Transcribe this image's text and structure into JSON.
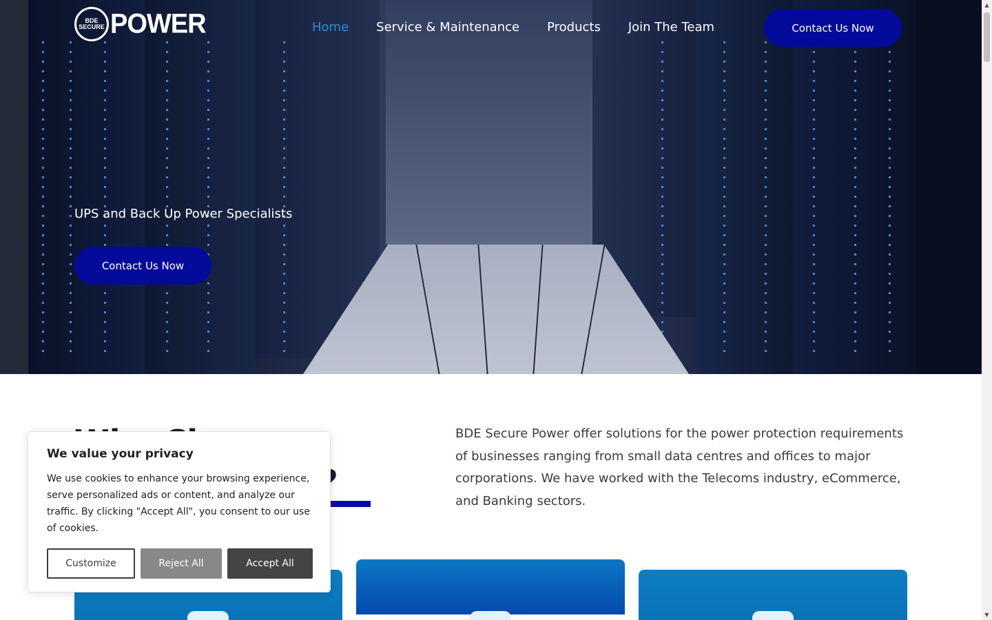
{
  "header": {
    "logo_badge": "BDE SECURE",
    "logo_text": "POWER",
    "nav": [
      "Home",
      "Service & Maintenance",
      "Products",
      "Join The Team"
    ],
    "cta": "Contact Us Now"
  },
  "hero": {
    "tagline": "UPS and Back Up Power Specialists",
    "cta": "Contact Us Now"
  },
  "about": {
    "heading": "Why Choose Secure Power?",
    "text": "BDE Secure Power offer solutions for the power protection requirements of businesses ranging from small data centres and offices to major corporations. We have worked with the Telecoms industry, eCommerce, and Banking sectors."
  },
  "cookie": {
    "title": "We value your privacy",
    "text": "We use cookies to enhance your browsing experience, serve personalized ads or content, and analyze our traffic. By clicking \"Accept All\", you consent to our use of cookies.",
    "customize": "Customize",
    "reject": "Reject All",
    "accept": "Accept All"
  },
  "colors": {
    "brand": "#040a9a",
    "nav_active": "#2f8bd8",
    "card": "#0a72b8"
  }
}
